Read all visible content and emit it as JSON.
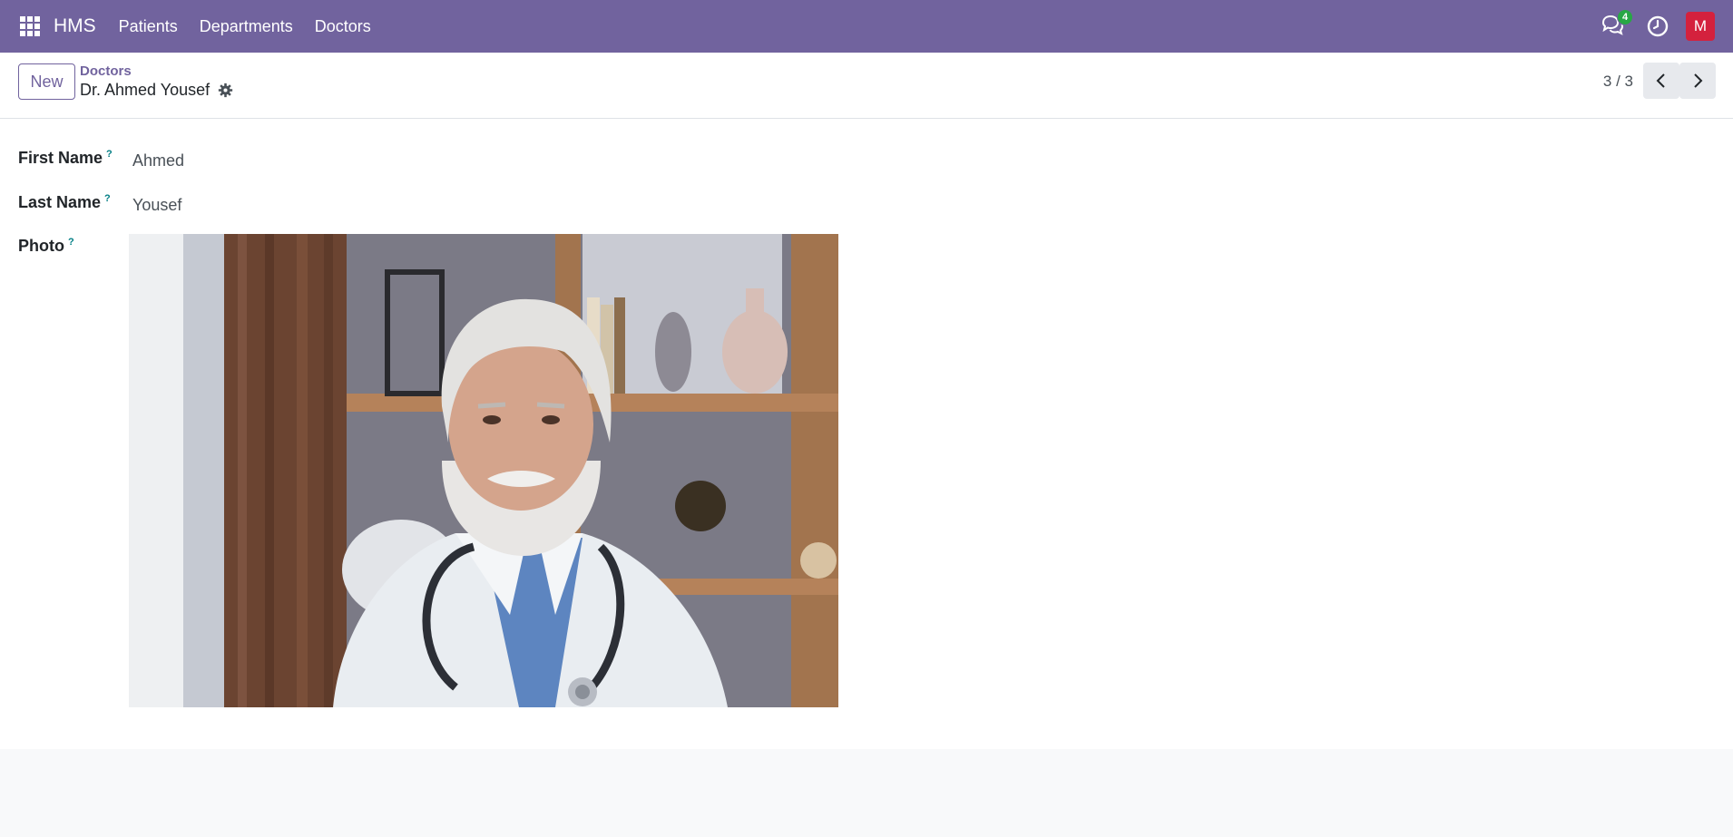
{
  "navbar": {
    "brand": "HMS",
    "menu": [
      "Patients",
      "Departments",
      "Doctors"
    ],
    "messages_count": "4",
    "user_initial": "M",
    "icons": [
      "apps-grid-icon",
      "chat-icon",
      "clock-icon"
    ],
    "colors": {
      "navbar_bg": "#71639e",
      "badge": "#28a745",
      "avatar_bg": "#d4213d"
    }
  },
  "control_panel": {
    "new_label": "New",
    "breadcrumb_parent": "Doctors",
    "breadcrumb_current": "Dr. Ahmed Yousef",
    "pager": "3 / 3"
  },
  "form": {
    "first_name_label": "First Name",
    "first_name_value": "Ahmed",
    "last_name_label": "Last Name",
    "last_name_value": "Yousef",
    "photo_label": "Photo",
    "help_mark": "?"
  }
}
